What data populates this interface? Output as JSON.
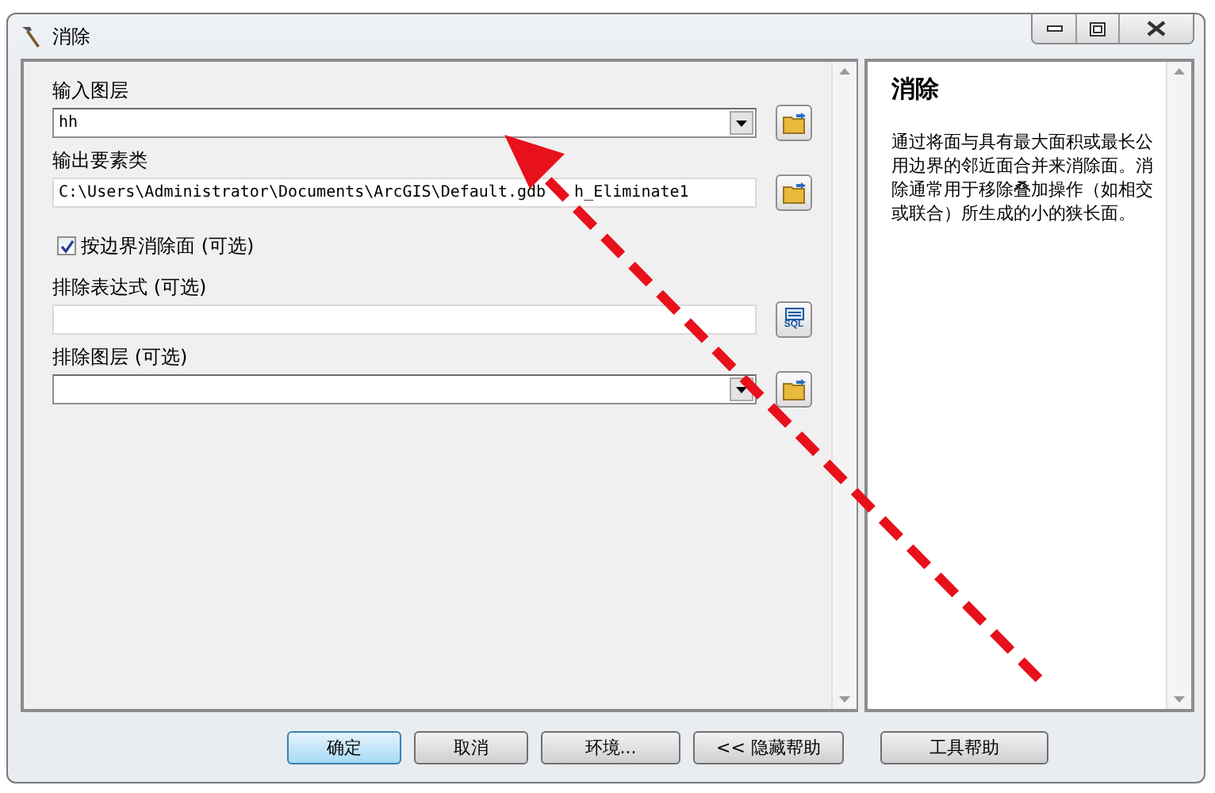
{
  "window": {
    "title": "消除"
  },
  "parameters": [
    {
      "kind": "dropdown",
      "label": "输入图层",
      "value": "hh"
    },
    {
      "kind": "text",
      "label": "输出要素类",
      "value": "C:\\Users\\Administrator\\Documents\\ArcGIS\\Default.gdb",
      "value_end": "h_Eliminate1"
    },
    {
      "kind": "checkbox",
      "label": "按边界消除面 (可选)",
      "checked": true
    },
    {
      "kind": "expression",
      "label": "排除表达式 (可选)",
      "button_text": "SQL"
    },
    {
      "kind": "dropdown",
      "label": "排除图层 (可选)"
    }
  ],
  "help": {
    "title": "消除",
    "body": "通过将面与具有最大面积或最长公用边界的邻近面合并来消除面。消除通常用于移除叠加操作（如相交或联合）所生成的小的狭长面。"
  },
  "buttons": [
    {
      "label": "确定",
      "selected": true
    },
    {
      "label": "取消",
      "selected": false
    },
    {
      "label": "环境...",
      "selected": false
    },
    {
      "label": "<< 隐藏帮助",
      "selected": false
    },
    {
      "label": "工具帮助",
      "selected": false
    }
  ]
}
